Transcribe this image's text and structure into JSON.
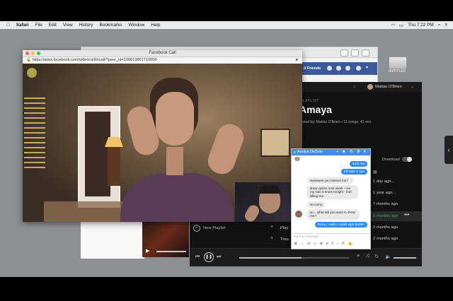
{
  "menubar": {
    "app": "Safari",
    "items": [
      "File",
      "Edit",
      "View",
      "History",
      "Bookmarks",
      "Window",
      "Help"
    ],
    "clock": "Thu 7:22 PM"
  },
  "fbcall": {
    "title": "Facebook Call",
    "url": "https://www.facebook.com/videocall/incall/?peer_id=100013861710058"
  },
  "bgbrowser": {
    "friends_label": "d Friends"
  },
  "desktop": {
    "drive_label": "UNTITLED"
  },
  "spotify": {
    "user": "Matias O'Brien",
    "section": "PLAYLIST",
    "playlist_title": "Amaya",
    "meta": "eated by: Matias O'Brien • 11 songs, 41 min",
    "download_label": "Download",
    "dates": [
      "1 day ago...",
      "1 year ago...",
      "7 months ago",
      "3 months ago",
      "2 months ago",
      "2 months ago"
    ],
    "new_playlist": "New Playlist",
    "track_a": "Play",
    "track_b": "Trou"
  },
  "messenger": {
    "contact": "Amaya DeSoto",
    "messages": [
      {
        "dir": "out",
        "text": "trust me"
      },
      {
        "dir": "out",
        "text": "it'll take 1 min"
      },
      {
        "dir": "in",
        "text": "awwwww you missed me?"
      },
      {
        "dir": "in",
        "text": "show opens next week - ran my solo 5 times tonight - feel killing me"
      },
      {
        "dir": "in",
        "text": "so corny"
      },
      {
        "dir": "in",
        "text": "ac... what did you want to show me?"
      },
      {
        "dir": "out",
        "text": "Sorry, I wish I could sign better."
      }
    ],
    "placeholder": "Type a message..."
  },
  "colors": {
    "spotify_green": "#1db954",
    "fb_blue": "#4a8be2",
    "bubble_blue": "#2f8cf5"
  }
}
